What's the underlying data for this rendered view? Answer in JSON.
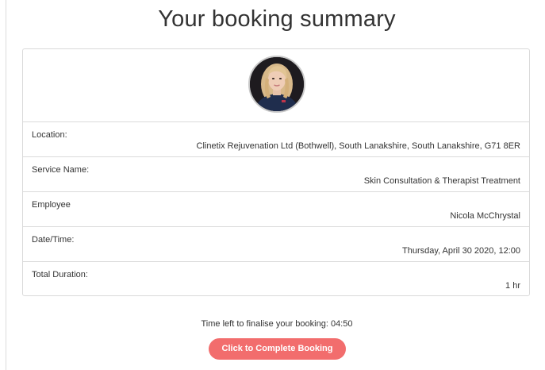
{
  "page": {
    "title": "Your booking summary"
  },
  "summary": {
    "rows": [
      {
        "label": "Location:",
        "value": "Clinetix Rejuvenation Ltd (Bothwell), South Lanakshire, South Lanakshire, G71 8ER"
      },
      {
        "label": "Service Name:",
        "value": "Skin Consultation & Therapist Treatment"
      },
      {
        "label": "Employee",
        "value": "Nicola McChrystal"
      },
      {
        "label": "Date/Time:",
        "value": "Thursday, April 30 2020, 12:00"
      },
      {
        "label": "Total Duration:",
        "value": "1 hr"
      }
    ]
  },
  "footer": {
    "timer_text": "Time left to finalise your booking: 04:50",
    "cta_label": "Click to Complete Booking"
  },
  "colors": {
    "accent": "#f26d6d",
    "border": "#dadada",
    "text": "#333333"
  }
}
